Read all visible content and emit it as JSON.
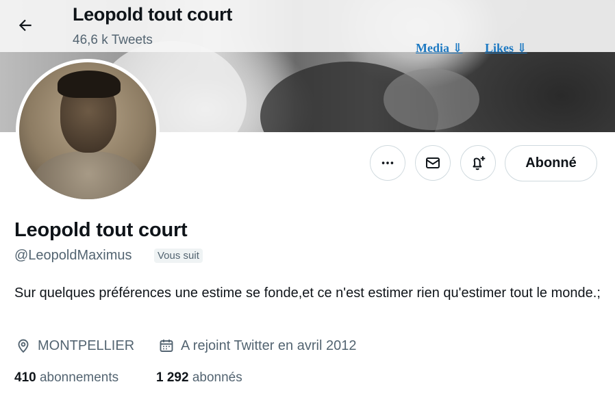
{
  "header": {
    "title": "Leopold tout court",
    "tweet_count": "46,6 k Tweets"
  },
  "banner_links": {
    "media": "Media ⇓",
    "likes": "Likes ⇓"
  },
  "actions": {
    "more_icon": "more-icon",
    "message_icon": "mail-icon",
    "notify_icon": "bell-plus-icon",
    "follow_label": "Abonné"
  },
  "profile": {
    "name": "Leopold tout court",
    "handle": "@LeopoldMaximus",
    "follows_you": "Vous suit",
    "bio": "Sur quelques préférences une estime se fonde,et ce n'est estimer rien qu'estimer tout le monde.;",
    "location": "MONTPELLIER",
    "joined": "A rejoint Twitter en avril 2012"
  },
  "stats": {
    "following_count": "410",
    "following_label": "abonnements",
    "followers_count": "1 292",
    "followers_label": "abonnés"
  },
  "colors": {
    "text_primary": "#0f1419",
    "text_secondary": "#536471",
    "link": "#1d79c2",
    "border": "#cfd9de"
  }
}
